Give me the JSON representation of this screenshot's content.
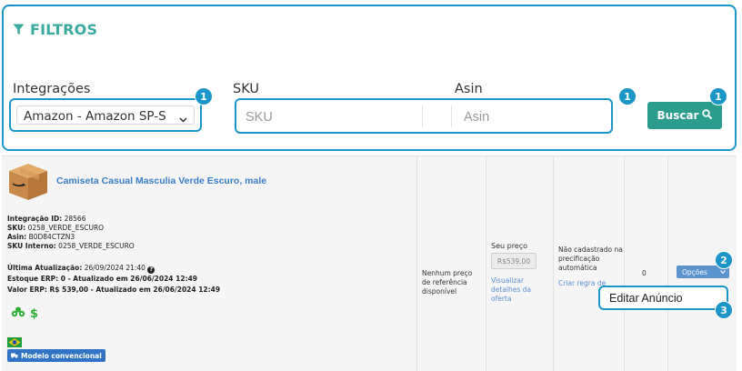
{
  "filters": {
    "title": "FILTROS",
    "integracoes_label": "Integrações",
    "integracoes_value": "Amazon - Amazon SP-S",
    "sku_label": "SKU",
    "sku_placeholder": "SKU",
    "asin_label": "Asin",
    "asin_placeholder": "Asin",
    "search_button": "Buscar"
  },
  "markers": {
    "m1": "1",
    "m2": "2",
    "m3": "3"
  },
  "product": {
    "title": "Camiseta Casual Masculia Verde Escuro, male",
    "integration_id_label": "Integração ID:",
    "integration_id": "28566",
    "sku_label": "SKU:",
    "sku": "0258_VERDE_ESCURO",
    "asin_label": "Asin:",
    "asin": "B0D84CTZN3",
    "sku_interno_label": "SKU Interno:",
    "sku_interno": "0258_VERDE_ESCURO",
    "last_update_label": "Última Atualização:",
    "last_update": "26/09/2024 21:40",
    "estoque_erp": "Estoque ERP: 0 - Atualizado em 26/06/2024 12:49",
    "valor_erp": "Valor ERP: R$ 539,00 - Atualizado em 26/06/2024 12:49",
    "dollar": "$",
    "badge": "Modelo convencional",
    "reference_price": "Nenhum preço de referência disponível",
    "your_price_label": "Seu preço",
    "your_price": "R$539.00",
    "offer_details_link": "Visualizar detalhes da oferta",
    "pricing_status": "Não cadastrado na precificação automática",
    "create_rule_link": "Criar regra de precificação",
    "count": "0",
    "options_button": "Opções",
    "dropdown_item": "Editar Anúncio"
  },
  "colors": {
    "accent_border": "#1b96c8",
    "filter_title": "#3aa99e",
    "search_button": "#2a9d8f",
    "link": "#3a7fc4",
    "options_button": "#5b93cf",
    "badge": "#3174c5"
  }
}
